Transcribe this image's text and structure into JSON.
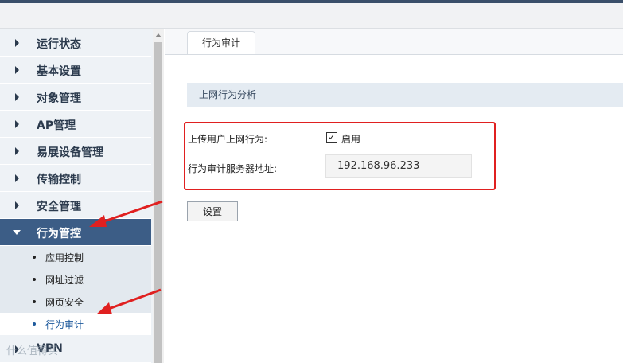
{
  "colors": {
    "accent": "#3c5d86",
    "highlight": "#e02020",
    "link": "#1e5a9c"
  },
  "sidebar": {
    "items": [
      {
        "label": "运行状态"
      },
      {
        "label": "基本设置"
      },
      {
        "label": "对象管理"
      },
      {
        "label": "AP管理"
      },
      {
        "label": "易展设备管理"
      },
      {
        "label": "传输控制"
      },
      {
        "label": "安全管理"
      },
      {
        "label": "行为管控",
        "expanded": true
      },
      {
        "label": "VPN"
      }
    ],
    "subitems": [
      {
        "label": "应用控制"
      },
      {
        "label": "网址过滤"
      },
      {
        "label": "网页安全"
      },
      {
        "label": "行为审计",
        "current": true
      }
    ]
  },
  "main": {
    "tab_label": "行为审计",
    "section_title": "上网行为分析",
    "upload_label": "上传用户上网行为:",
    "enable_label": "启用",
    "enable_checked": true,
    "checkbox_mark": "✓",
    "server_label": "行为审计服务器地址:",
    "server_value": "192.168.96.233",
    "set_button": "设置"
  },
  "watermark": "什么值得买"
}
